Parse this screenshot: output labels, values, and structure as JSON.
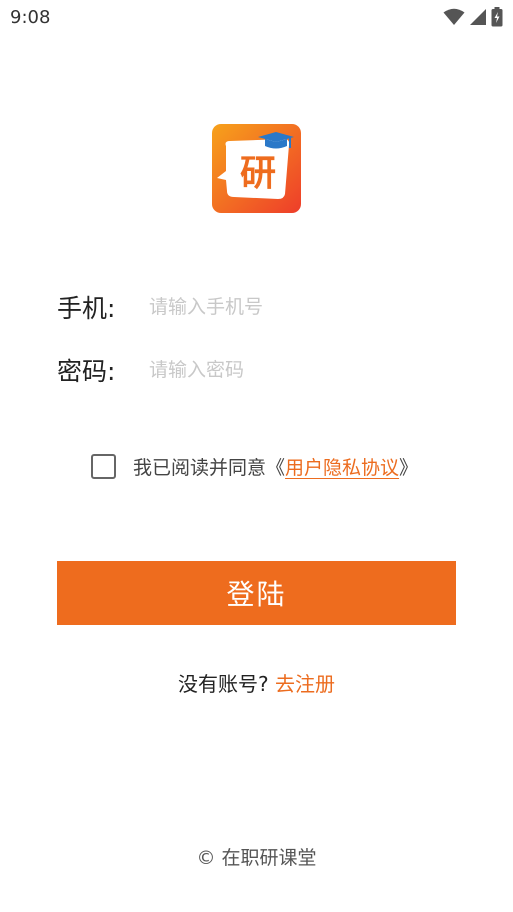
{
  "status_bar": {
    "time": "9:08",
    "icons": [
      "wifi-icon",
      "signal-icon",
      "battery-icon"
    ]
  },
  "app": {
    "logo_char": "研",
    "brand_color": "#ee6c1e",
    "logo_gradient": [
      "#f7a21b",
      "#ee3d2a"
    ]
  },
  "form": {
    "phone_label": "手机:",
    "phone_placeholder": "请输入手机号",
    "phone_value": "",
    "password_label": "密码:",
    "password_placeholder": "请输入密码",
    "password_value": ""
  },
  "agreement": {
    "checked": false,
    "text": "我已阅读并同意",
    "open_bracket": "《",
    "link": "用户隐私协议",
    "close_bracket": "》"
  },
  "login_button": "登陆",
  "register": {
    "prompt": "没有账号?",
    "link": "去注册"
  },
  "footer": "© 在职研课堂"
}
